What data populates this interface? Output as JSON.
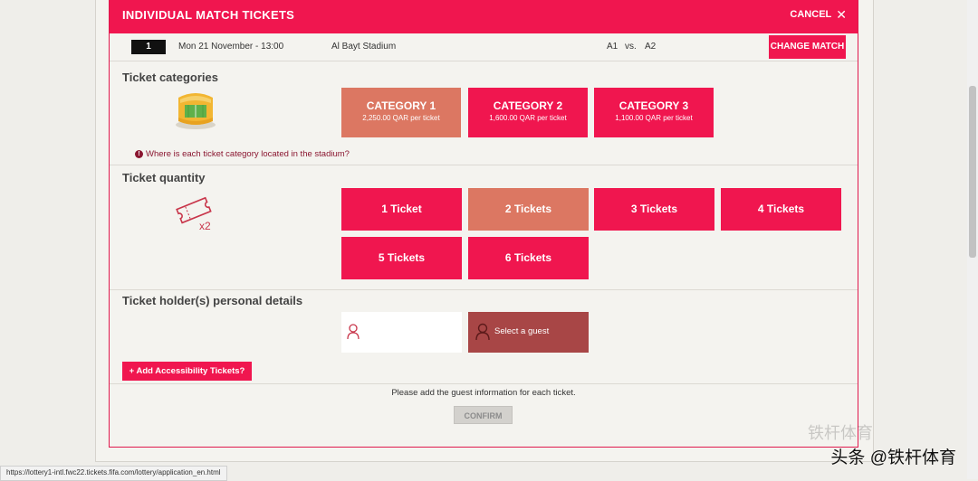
{
  "header": {
    "title": "INDIVIDUAL MATCH TICKETS",
    "cancel_label": "CANCEL"
  },
  "match": {
    "number": "1",
    "date": "Mon 21 November - 13:00",
    "stadium": "Al Bayt Stadium",
    "team_a": "A1",
    "vs": "vs.",
    "team_b": "A2",
    "change_label": "CHANGE MATCH"
  },
  "categories": {
    "title": "Ticket categories",
    "selected": 0,
    "items": [
      {
        "name": "CATEGORY 1",
        "price": "2,250.00 QAR per ticket"
      },
      {
        "name": "CATEGORY 2",
        "price": "1,600.00 QAR per ticket"
      },
      {
        "name": "CATEGORY 3",
        "price": "1,100.00 QAR per ticket"
      }
    ],
    "info_link": "Where is each ticket category located in the stadium?"
  },
  "quantity": {
    "title": "Ticket quantity",
    "icon_label": "x2",
    "selected": 1,
    "items": [
      "1 Ticket",
      "2 Tickets",
      "3 Tickets",
      "4 Tickets",
      "5 Tickets",
      "6 Tickets"
    ]
  },
  "holders": {
    "title": "Ticket holder(s) personal details",
    "select_guest": "Select a guest",
    "accessibility_label": "Add Accessibility Tickets?",
    "note": "Please add the guest information for each ticket.",
    "confirm_label": "CONFIRM"
  },
  "status_url": "https://lottery1-intl.fwc22.tickets.fifa.com/lottery/application_en.html",
  "watermark": {
    "text": "头条 @铁杆体育",
    "ghost": "铁杆体育"
  },
  "colors": {
    "brand": "#f0164f",
    "selected": "#dc7762",
    "guest_select": "#a84646",
    "info": "#8a1630"
  }
}
